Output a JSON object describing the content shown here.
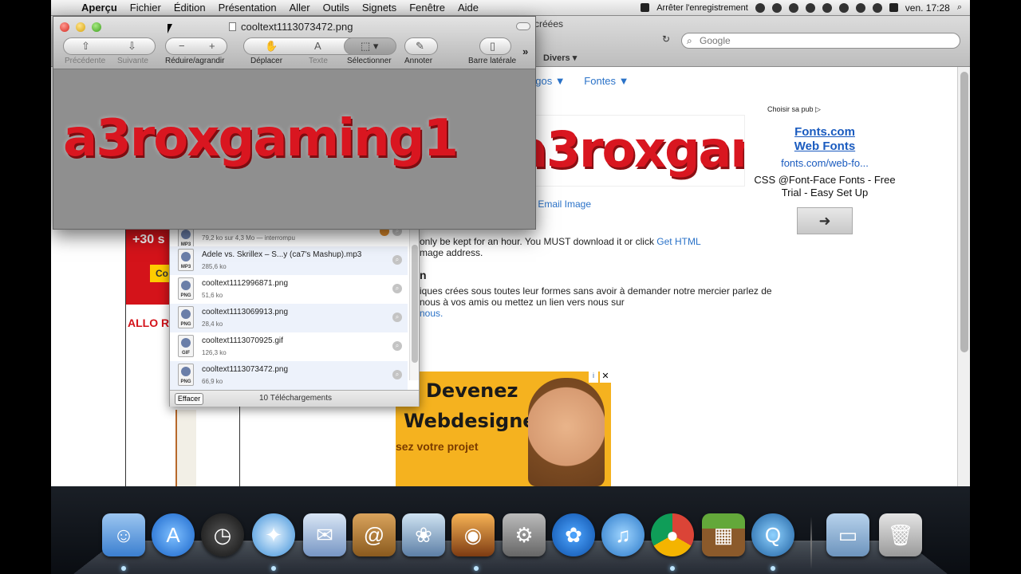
{
  "menubar": {
    "app_name": "Aperçu",
    "items": [
      "Fichier",
      "Édition",
      "Présentation",
      "Aller",
      "Outils",
      "Signets",
      "Fenêtre",
      "Aide"
    ],
    "recording": "Arrêter l'enregistrement",
    "clock": "ven. 17:28"
  },
  "browser": {
    "title_fragment": "créées",
    "search_placeholder": "Google",
    "bookmark_divers": "Divers ▾",
    "nav_links": [
      "ogos ▼",
      "Fontes ▼"
    ],
    "logo_text": "a3roxgaming1",
    "email_image": "- Email Image",
    "body": {
      "line1_pre": "only be kept for an hour. You MUST download it or click ",
      "line1_link": "Get HTML",
      "line2": "mage address.",
      "heading_fragment": "n",
      "para2": "iques crées sous toutes leur formes sans avoir à demander notre mercier parlez de nous à vos amis ou mettez un lien vers nous sur",
      "para2_link": "nous."
    },
    "side_ad": {
      "choose": "Choisir sa pub ▷",
      "title_line1": "Fonts.com",
      "title_line2": "Web Fonts",
      "url": "fonts.com/web-fo...",
      "desc": "CSS @Font-Face Fonts - Free Trial - Easy Set Up",
      "arrow": "➜"
    },
    "left_ad": {
      "plus30": "+30 s",
      "co": "Co",
      "allo": "ALLO RESTO"
    },
    "banner": {
      "line1": "Devenez",
      "line2": "Webdesigner",
      "line3": "sez votre projet",
      "close": "✕",
      "info": "i"
    }
  },
  "downloads": {
    "items": [
      {
        "name": "",
        "size": "79,2 ko sur 4,3 Mo — interrompu",
        "ext": "MP3"
      },
      {
        "name": "Adele vs. Skrillex – S...y (ca7's Mashup).mp3",
        "size": "285,6 ko",
        "ext": "MP3"
      },
      {
        "name": "cooltext1112996871.png",
        "size": "51,6 ko",
        "ext": "PNG"
      },
      {
        "name": "cooltext1113069913.png",
        "size": "28,4 ko",
        "ext": "PNG"
      },
      {
        "name": "cooltext1113070925.gif",
        "size": "126,3 ko",
        "ext": "GIF"
      },
      {
        "name": "cooltext1113073472.png",
        "size": "66,9 ko",
        "ext": "PNG"
      }
    ],
    "clear_label": "Effacer",
    "count_label": "10 Téléchargements"
  },
  "preview": {
    "title": "cooltext1113073472.png",
    "toolbar": {
      "prev": "Précédente",
      "next": "Suivante",
      "zoom": "Réduire/agrandir",
      "move": "Déplacer",
      "text": "Texte",
      "select": "Sélectionner",
      "annotate": "Annoter",
      "sidebar": "Barre latérale",
      "more": "»"
    },
    "image_text": "a3roxgaming1"
  },
  "dock": {
    "apps": [
      "Finder",
      "App Store",
      "Dashboard",
      "Safari",
      "Mail",
      "Carnet d'adresses",
      "iPhoto",
      "Photo Booth",
      "Préférences Système",
      "Boxee",
      "iTunes",
      "Google Chrome",
      "Minecraft",
      "QuickTime Player",
      "Documents",
      "Corbeille"
    ]
  }
}
